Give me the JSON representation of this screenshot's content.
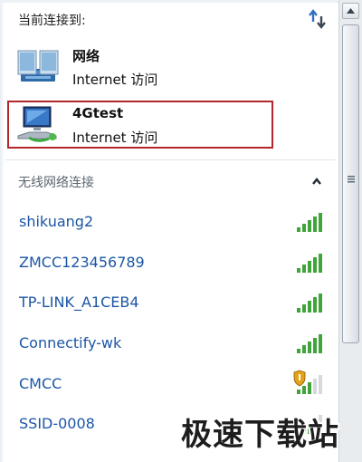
{
  "header": {
    "title": "当前连接到:",
    "refresh_icon": "refresh-icon"
  },
  "connected": [
    {
      "name": "网络",
      "access": "Internet 访问",
      "icon": "network-icon"
    },
    {
      "name": "4Gtest",
      "access": "Internet 访问",
      "icon": "network-computer-icon"
    }
  ],
  "wireless": {
    "title": "无线网络连接",
    "collapse_icon": "chevron-up-icon",
    "networks": [
      {
        "ssid": "shikuang2",
        "signal": 5,
        "secured": false
      },
      {
        "ssid": "ZMCC123456789",
        "signal": 5,
        "secured": false
      },
      {
        "ssid": "TP-LINK_A1CEB4",
        "signal": 5,
        "secured": false
      },
      {
        "ssid": "Connectify-wk",
        "signal": 5,
        "secured": false
      },
      {
        "ssid": "CMCC",
        "signal": 3,
        "secured": true
      },
      {
        "ssid": "SSID-0008",
        "signal": 3,
        "secured": false
      }
    ]
  },
  "watermark": "极速下载站",
  "colors": {
    "ssid": "#1b56a5",
    "signal": "#3fa43a",
    "highlight_border": "#b3262a"
  }
}
